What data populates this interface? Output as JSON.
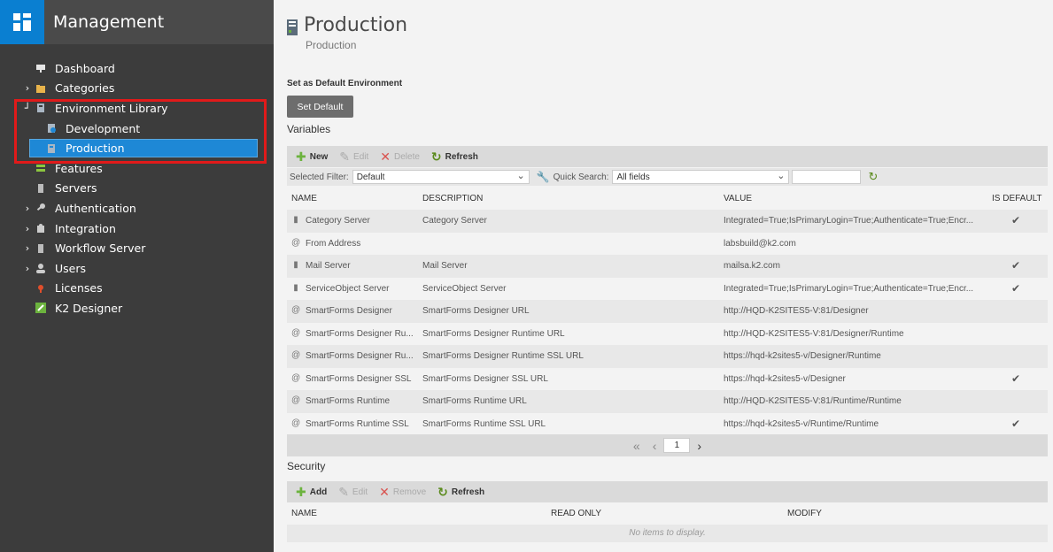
{
  "sidebar": {
    "title": "Management",
    "items": [
      {
        "label": "Dashboard",
        "arrow": "",
        "icon": "dashboard-icon"
      },
      {
        "label": "Categories",
        "arrow": "›",
        "icon": "folder-icon"
      },
      {
        "label": "Environment Library",
        "arrow": "⌐",
        "icon": "environment-icon"
      },
      {
        "label": "Development",
        "arrow": "",
        "icon": "development-icon"
      },
      {
        "label": "Production",
        "arrow": "",
        "icon": "production-icon"
      },
      {
        "label": "Features",
        "arrow": "",
        "icon": "features-icon"
      },
      {
        "label": "Servers",
        "arrow": "",
        "icon": "server-icon"
      },
      {
        "label": "Authentication",
        "arrow": "›",
        "icon": "key-icon"
      },
      {
        "label": "Integration",
        "arrow": "›",
        "icon": "puzzle-icon"
      },
      {
        "label": "Workflow Server",
        "arrow": "›",
        "icon": "server-icon"
      },
      {
        "label": "Users",
        "arrow": "›",
        "icon": "user-icon"
      },
      {
        "label": "Licenses",
        "arrow": "",
        "icon": "license-icon"
      },
      {
        "label": "K2 Designer",
        "arrow": "",
        "icon": "designer-icon"
      }
    ]
  },
  "page": {
    "title": "Production",
    "subtitle": "Production"
  },
  "default_env": {
    "label": "Set as Default Environment",
    "button": "Set Default"
  },
  "variables": {
    "heading": "Variables",
    "toolbar": {
      "new": "New",
      "edit": "Edit",
      "delete": "Delete",
      "refresh": "Refresh"
    },
    "filter": {
      "selected_label": "Selected Filter:",
      "selected_value": "Default",
      "quick_label": "Quick Search:",
      "quick_value": "All fields",
      "search_value": ""
    },
    "columns": {
      "name": "NAME",
      "description": "DESCRIPTION",
      "value": "VALUE",
      "is_default": "IS DEFAULT"
    },
    "rows": [
      {
        "icon": "server-icon",
        "name": "Category Server",
        "description": "Category Server",
        "value": "Integrated=True;IsPrimaryLogin=True;Authenticate=True;Encr...",
        "is_default": true
      },
      {
        "icon": "at-icon",
        "name": "From Address",
        "description": "",
        "value": "labsbuild@k2.com",
        "is_default": false
      },
      {
        "icon": "server-icon",
        "name": "Mail Server",
        "description": "Mail Server",
        "value": "mailsa.k2.com",
        "is_default": true
      },
      {
        "icon": "server-icon",
        "name": "ServiceObject Server",
        "description": "ServiceObject Server",
        "value": "Integrated=True;IsPrimaryLogin=True;Authenticate=True;Encr...",
        "is_default": true
      },
      {
        "icon": "at-icon",
        "name": "SmartForms Designer",
        "description": "SmartForms Designer URL",
        "value": "http://HQD-K2SITES5-V:81/Designer",
        "is_default": false
      },
      {
        "icon": "at-icon",
        "name": "SmartForms Designer Ru...",
        "description": "SmartForms Designer Runtime URL",
        "value": "http://HQD-K2SITES5-V:81/Designer/Runtime",
        "is_default": false
      },
      {
        "icon": "at-icon",
        "name": "SmartForms Designer Ru...",
        "description": "SmartForms Designer Runtime SSL URL",
        "value": "https://hqd-k2sites5-v/Designer/Runtime",
        "is_default": false
      },
      {
        "icon": "at-icon",
        "name": "SmartForms Designer SSL",
        "description": "SmartForms Designer SSL URL",
        "value": "https://hqd-k2sites5-v/Designer",
        "is_default": true
      },
      {
        "icon": "at-icon",
        "name": "SmartForms Runtime",
        "description": "SmartForms Runtime URL",
        "value": "http://HQD-K2SITES5-V:81/Runtime/Runtime",
        "is_default": false
      },
      {
        "icon": "at-icon",
        "name": "SmartForms Runtime SSL",
        "description": "SmartForms Runtime SSL URL",
        "value": "https://hqd-k2sites5-v/Runtime/Runtime",
        "is_default": true
      }
    ],
    "pager": {
      "page": "1",
      "first": "«",
      "prev": "‹",
      "next": "›"
    }
  },
  "security": {
    "heading": "Security",
    "toolbar": {
      "add": "Add",
      "edit": "Edit",
      "remove": "Remove",
      "refresh": "Refresh"
    },
    "columns": {
      "name": "NAME",
      "read_only": "READ ONLY",
      "modify": "MODIFY"
    },
    "empty": "No items to display."
  },
  "colors": {
    "sidebar": "#3c3c3c",
    "logo": "#0a7fd1",
    "selected": "#1e88d6",
    "highlight_box": "#e11a1a",
    "add_icon": "#6cb33e",
    "delete_icon": "#d9534f",
    "refresh_icon": "#5a8a1c"
  }
}
